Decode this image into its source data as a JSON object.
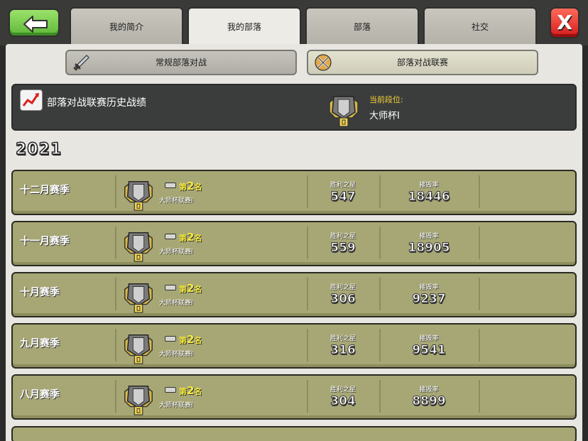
{
  "header": {
    "tabs": [
      {
        "label": "我的简介"
      },
      {
        "label": "我的部落"
      },
      {
        "label": "部落"
      },
      {
        "label": "社交"
      }
    ],
    "back_icon": "back-arrow-icon",
    "close_label": "X"
  },
  "subtabs": {
    "regular": "常规部落对战",
    "league": "部落对战联赛"
  },
  "banner": {
    "title": "部落对战联赛历史战绩",
    "rank_label": "当前段位:",
    "rank_value": "大师杯I"
  },
  "year": "2021",
  "stat_labels": {
    "stars": "胜利之星",
    "destruction": "摧毁率"
  },
  "seasons": [
    {
      "name": "十二月赛季",
      "place_prefix": "第",
      "place": "2",
      "place_suffix": "名",
      "league": "大师杯联赛I",
      "stars": "547",
      "destruction": "18446"
    },
    {
      "name": "十一月赛季",
      "place_prefix": "第",
      "place": "2",
      "place_suffix": "名",
      "league": "大师杯联赛I",
      "stars": "559",
      "destruction": "18905"
    },
    {
      "name": "十月赛季",
      "place_prefix": "第",
      "place": "2",
      "place_suffix": "名",
      "league": "大师杯联赛I",
      "stars": "306",
      "destruction": "9237"
    },
    {
      "name": "九月赛季",
      "place_prefix": "第",
      "place": "2",
      "place_suffix": "名",
      "league": "大师杯联赛I",
      "stars": "316",
      "destruction": "9541"
    },
    {
      "name": "八月赛季",
      "place_prefix": "第",
      "place": "2",
      "place_suffix": "名",
      "league": "大师杯联赛I",
      "stars": "304",
      "destruction": "8899"
    }
  ],
  "colors": {
    "row_bg": "#a7a776",
    "place_text": "#f5ea3a",
    "rank_label": "#f5d33a"
  }
}
